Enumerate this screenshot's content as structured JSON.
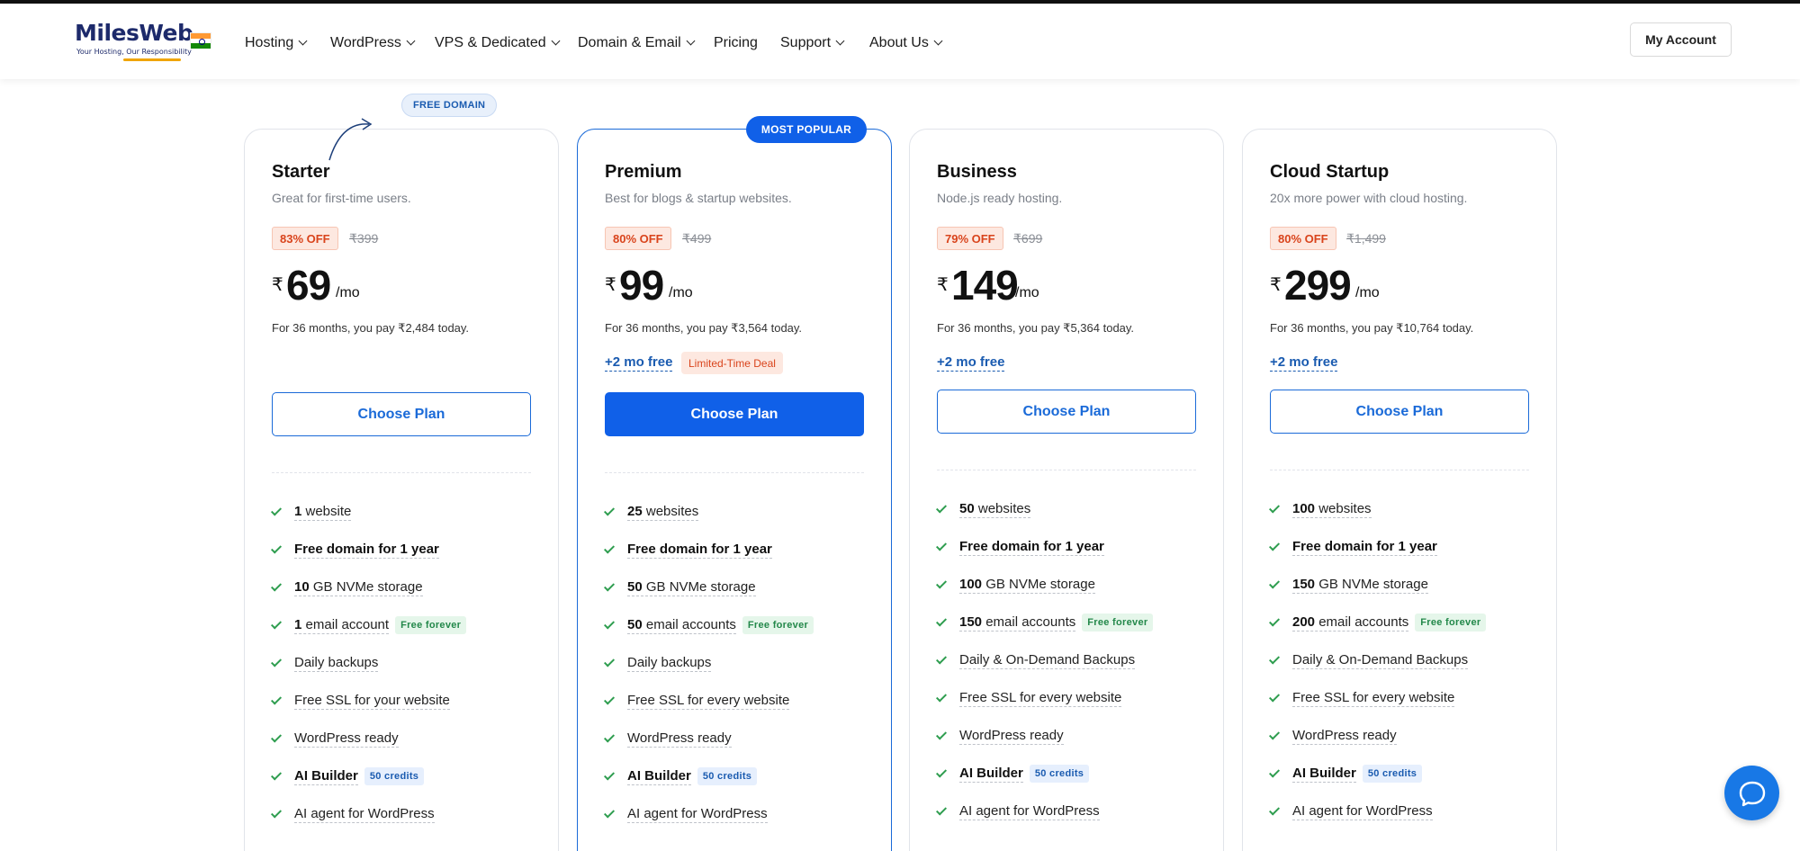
{
  "header": {
    "logo_text": "MilesWeb",
    "logo_tagline": "Your Hosting, Our Responsibility",
    "nav": [
      "Hosting",
      "WordPress",
      "VPS & Dedicated",
      "Domain & Email",
      "Pricing",
      "Support",
      "About Us"
    ],
    "account_label": "My Account"
  },
  "promo": {
    "free_domain": "FREE DOMAIN",
    "most_popular": "MOST POPULAR"
  },
  "plans": [
    {
      "name": "Starter",
      "desc": "Great for first-time users.",
      "discount": "83% OFF",
      "original": "₹399",
      "currency": "₹",
      "price": "69",
      "per": "/mo",
      "note": "For 36 months, you pay ₹2,484 today.",
      "free_mo": "",
      "limited": "",
      "choose": "Choose Plan",
      "features": {
        "websites_count": "1",
        "websites_label": " website",
        "domain": "Free domain for 1 year",
        "storage_count": "10",
        "storage_label": " GB NVMe storage",
        "email_count": "1",
        "email_label": " email account",
        "email_badge": "Free forever",
        "backups": "Daily backups",
        "ssl": "Free SSL for your website",
        "wp": "WordPress ready",
        "ai": "AI Builder",
        "ai_badge": "50 credits",
        "agent": "AI agent for WordPress"
      }
    },
    {
      "name": "Premium",
      "desc": "Best for blogs & startup websites.",
      "discount": "80% OFF",
      "original": "₹499",
      "currency": "₹",
      "price": "99",
      "per": "/mo",
      "note": "For 36 months, you pay ₹3,564 today.",
      "free_mo": "+2 mo free",
      "limited": "Limited-Time Deal",
      "choose": "Choose Plan",
      "features": {
        "websites_count": "25",
        "websites_label": " websites",
        "domain": "Free domain for 1 year",
        "storage_count": "50",
        "storage_label": " GB NVMe storage",
        "email_count": "50",
        "email_label": " email accounts",
        "email_badge": "Free forever",
        "backups": "Daily backups",
        "ssl": "Free SSL for every website",
        "wp": "WordPress ready",
        "ai": "AI Builder",
        "ai_badge": "50 credits",
        "agent": "AI agent for WordPress"
      }
    },
    {
      "name": "Business",
      "desc": "Node.js ready hosting.",
      "discount": "79% OFF",
      "original": "₹699",
      "currency": "₹",
      "price": "149",
      "per": "/mo",
      "note": "For 36 months, you pay ₹5,364 today.",
      "free_mo": "+2 mo free",
      "limited": "",
      "choose": "Choose Plan",
      "features": {
        "websites_count": "50",
        "websites_label": " websites",
        "domain": "Free domain for 1 year",
        "storage_count": "100",
        "storage_label": " GB NVMe storage",
        "email_count": "150",
        "email_label": " email accounts",
        "email_badge": "Free forever",
        "backups": "Daily & On-Demand Backups",
        "ssl": "Free SSL for every website",
        "wp": "WordPress ready",
        "ai": "AI Builder",
        "ai_badge": "50 credits",
        "agent": "AI agent for WordPress"
      }
    },
    {
      "name": "Cloud Startup",
      "desc": "20x more power with cloud hosting.",
      "discount": "80% OFF",
      "original": "₹1,499",
      "currency": "₹",
      "price": "299",
      "per": "/mo",
      "note": "For 36 months, you pay ₹10,764 today.",
      "free_mo": "+2 mo free",
      "limited": "",
      "choose": "Choose Plan",
      "features": {
        "websites_count": "100",
        "websites_label": " websites",
        "domain": "Free domain for 1 year",
        "storage_count": "150",
        "storage_label": " GB NVMe storage",
        "email_count": "200",
        "email_label": " email accounts",
        "email_badge": "Free forever",
        "backups": "Daily & On-Demand Backups",
        "ssl": "Free SSL for every website",
        "wp": "WordPress ready",
        "ai": "AI Builder",
        "ai_badge": "50 credits",
        "agent": "AI agent for WordPress"
      }
    }
  ],
  "icons": {
    "check": "check-icon",
    "chevron": "chevron-down-icon",
    "chat": "chat-bubble-icon"
  },
  "colors": {
    "brand_blue": "#1060e8",
    "discount_red": "#d9441c",
    "check_green": "#2e9d4f",
    "logo_navy": "#1d2a6b"
  }
}
